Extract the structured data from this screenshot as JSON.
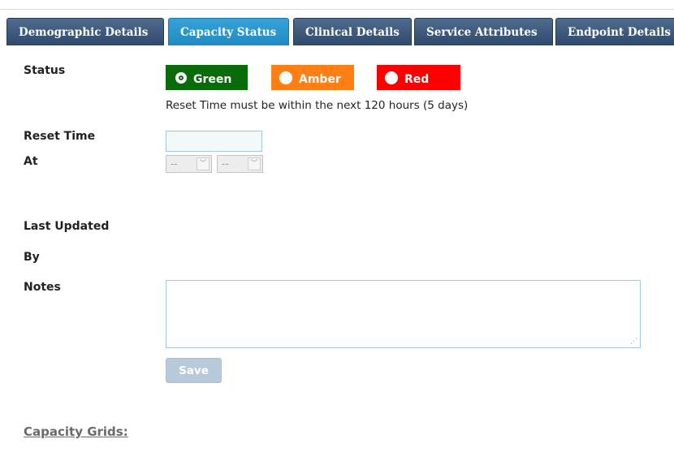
{
  "tabs": [
    {
      "label": "Demographic Details",
      "active": false
    },
    {
      "label": "Capacity Status",
      "active": true
    },
    {
      "label": "Clinical Details",
      "active": false
    },
    {
      "label": "Service Attributes",
      "active": false
    },
    {
      "label": "Endpoint Details",
      "active": false
    }
  ],
  "form": {
    "status_label": "Status",
    "status_options": [
      {
        "label": "Green",
        "color": "#0a6b0a",
        "selected": true
      },
      {
        "label": "Amber",
        "color": "#ff7f14",
        "selected": false
      },
      {
        "label": "Red",
        "color": "#ff0000",
        "selected": false
      }
    ],
    "hint": "Reset Time must be within the next 120 hours (5 days)",
    "reset_time_label": "Reset Time",
    "reset_time_value": "",
    "at_label": "At",
    "hour_select": "--",
    "minute_select": "--",
    "last_updated_label": "Last Updated",
    "by_label": "By",
    "notes_label": "Notes",
    "notes_value": "",
    "save_label": "Save"
  },
  "capacity_grids_label": "Capacity Grids:"
}
